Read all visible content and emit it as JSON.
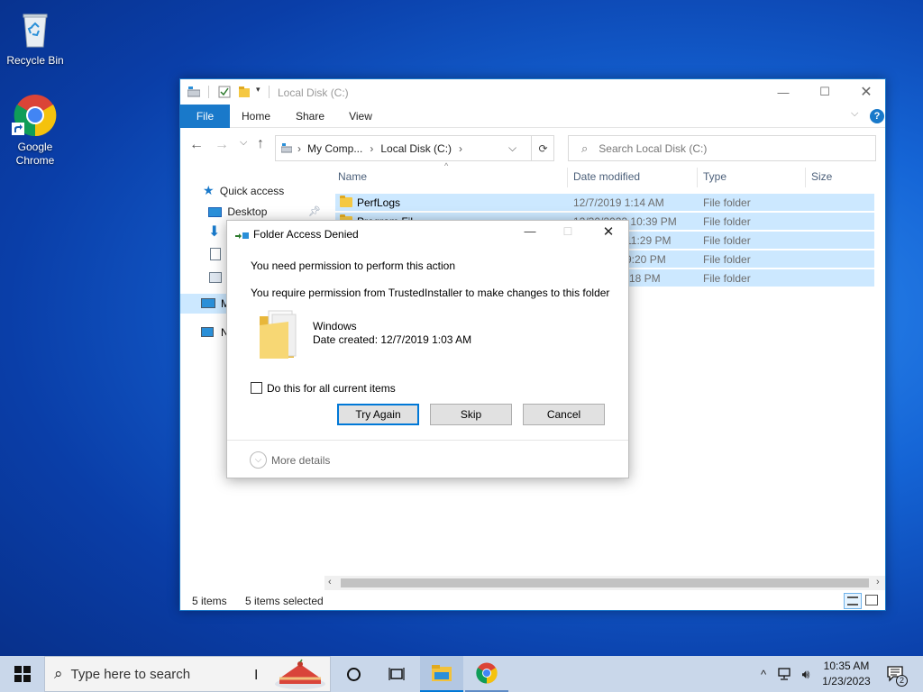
{
  "desktop": {
    "icons": [
      {
        "label": "Recycle Bin"
      },
      {
        "label": "Google Chrome"
      }
    ]
  },
  "explorer": {
    "title": "Local Disk (C:)",
    "ribbon_tabs": [
      "File",
      "Home",
      "Share",
      "View"
    ],
    "breadcrumb": [
      "My Comp...",
      "Local Disk (C:)"
    ],
    "search_placeholder": "Search Local Disk (C:)",
    "nav": {
      "quick_access": "Quick access",
      "desktop": "Desktop",
      "this_pc_initial": "M",
      "network_initial": "N"
    },
    "columns": [
      "Name",
      "Date modified",
      "Type",
      "Size"
    ],
    "rows": [
      {
        "name": "PerfLogs",
        "date": "12/7/2019 1:14 AM",
        "type": "File folder"
      },
      {
        "name": "Program Fil",
        "date": "12/30/2022 10:39 PM",
        "type": "File folder"
      },
      {
        "name": "",
        "date": "11:29 PM",
        "type": "File folder"
      },
      {
        "name": "",
        "date": "9:20 PM",
        "type": "File folder"
      },
      {
        "name": "",
        "date": "18 PM",
        "type": "File folder"
      }
    ],
    "status": {
      "items": "5 items",
      "selected": "5 items selected"
    }
  },
  "dialog": {
    "title": "Folder Access Denied",
    "heading": "You need permission to perform this action",
    "message": "You require permission from TrustedInstaller to make changes to this folder",
    "item_name": "Windows",
    "item_date": "Date created: 12/7/2019 1:03 AM",
    "checkbox_label": "Do this for all current items",
    "checkbox_checked": false,
    "buttons": {
      "try_again": "Try Again",
      "skip": "Skip",
      "cancel": "Cancel"
    },
    "more_details": "More details"
  },
  "taskbar": {
    "search_placeholder": "Type here to search",
    "clock_time": "10:35 AM",
    "clock_date": "1/23/2023",
    "notification_count": "2"
  },
  "colors": {
    "accent": "#0078d7",
    "selection": "#cce8ff",
    "file_tab": "#1979ca"
  }
}
